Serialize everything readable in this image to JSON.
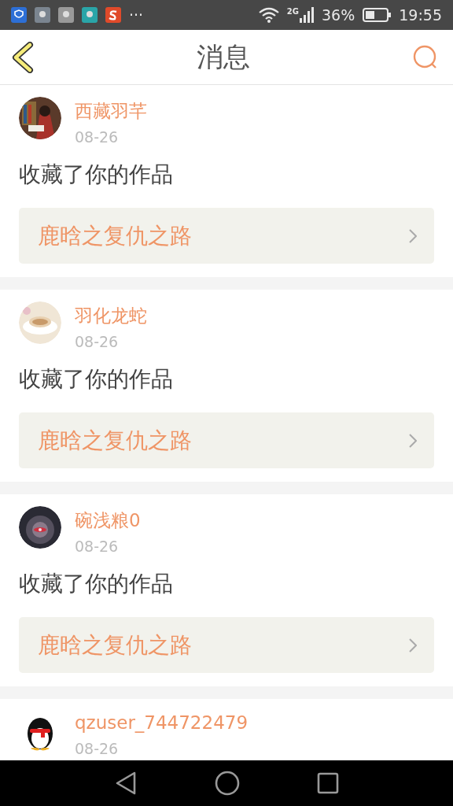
{
  "status_bar": {
    "network": "2G",
    "battery": "36%",
    "time": "19:55",
    "more": "···"
  },
  "header": {
    "title": "消息"
  },
  "messages": [
    {
      "user": "西藏羽芊",
      "date": "08-26",
      "action": "收藏了你的作品",
      "work": "鹿晗之复仇之路"
    },
    {
      "user": "羽化龙蛇",
      "date": "08-26",
      "action": "收藏了你的作品",
      "work": "鹿晗之复仇之路"
    },
    {
      "user": "碗浅粮0",
      "date": "08-26",
      "action": "收藏了你的作品",
      "work": "鹿晗之复仇之路"
    },
    {
      "user": "qzuser_744722479",
      "date": "08-26"
    }
  ]
}
